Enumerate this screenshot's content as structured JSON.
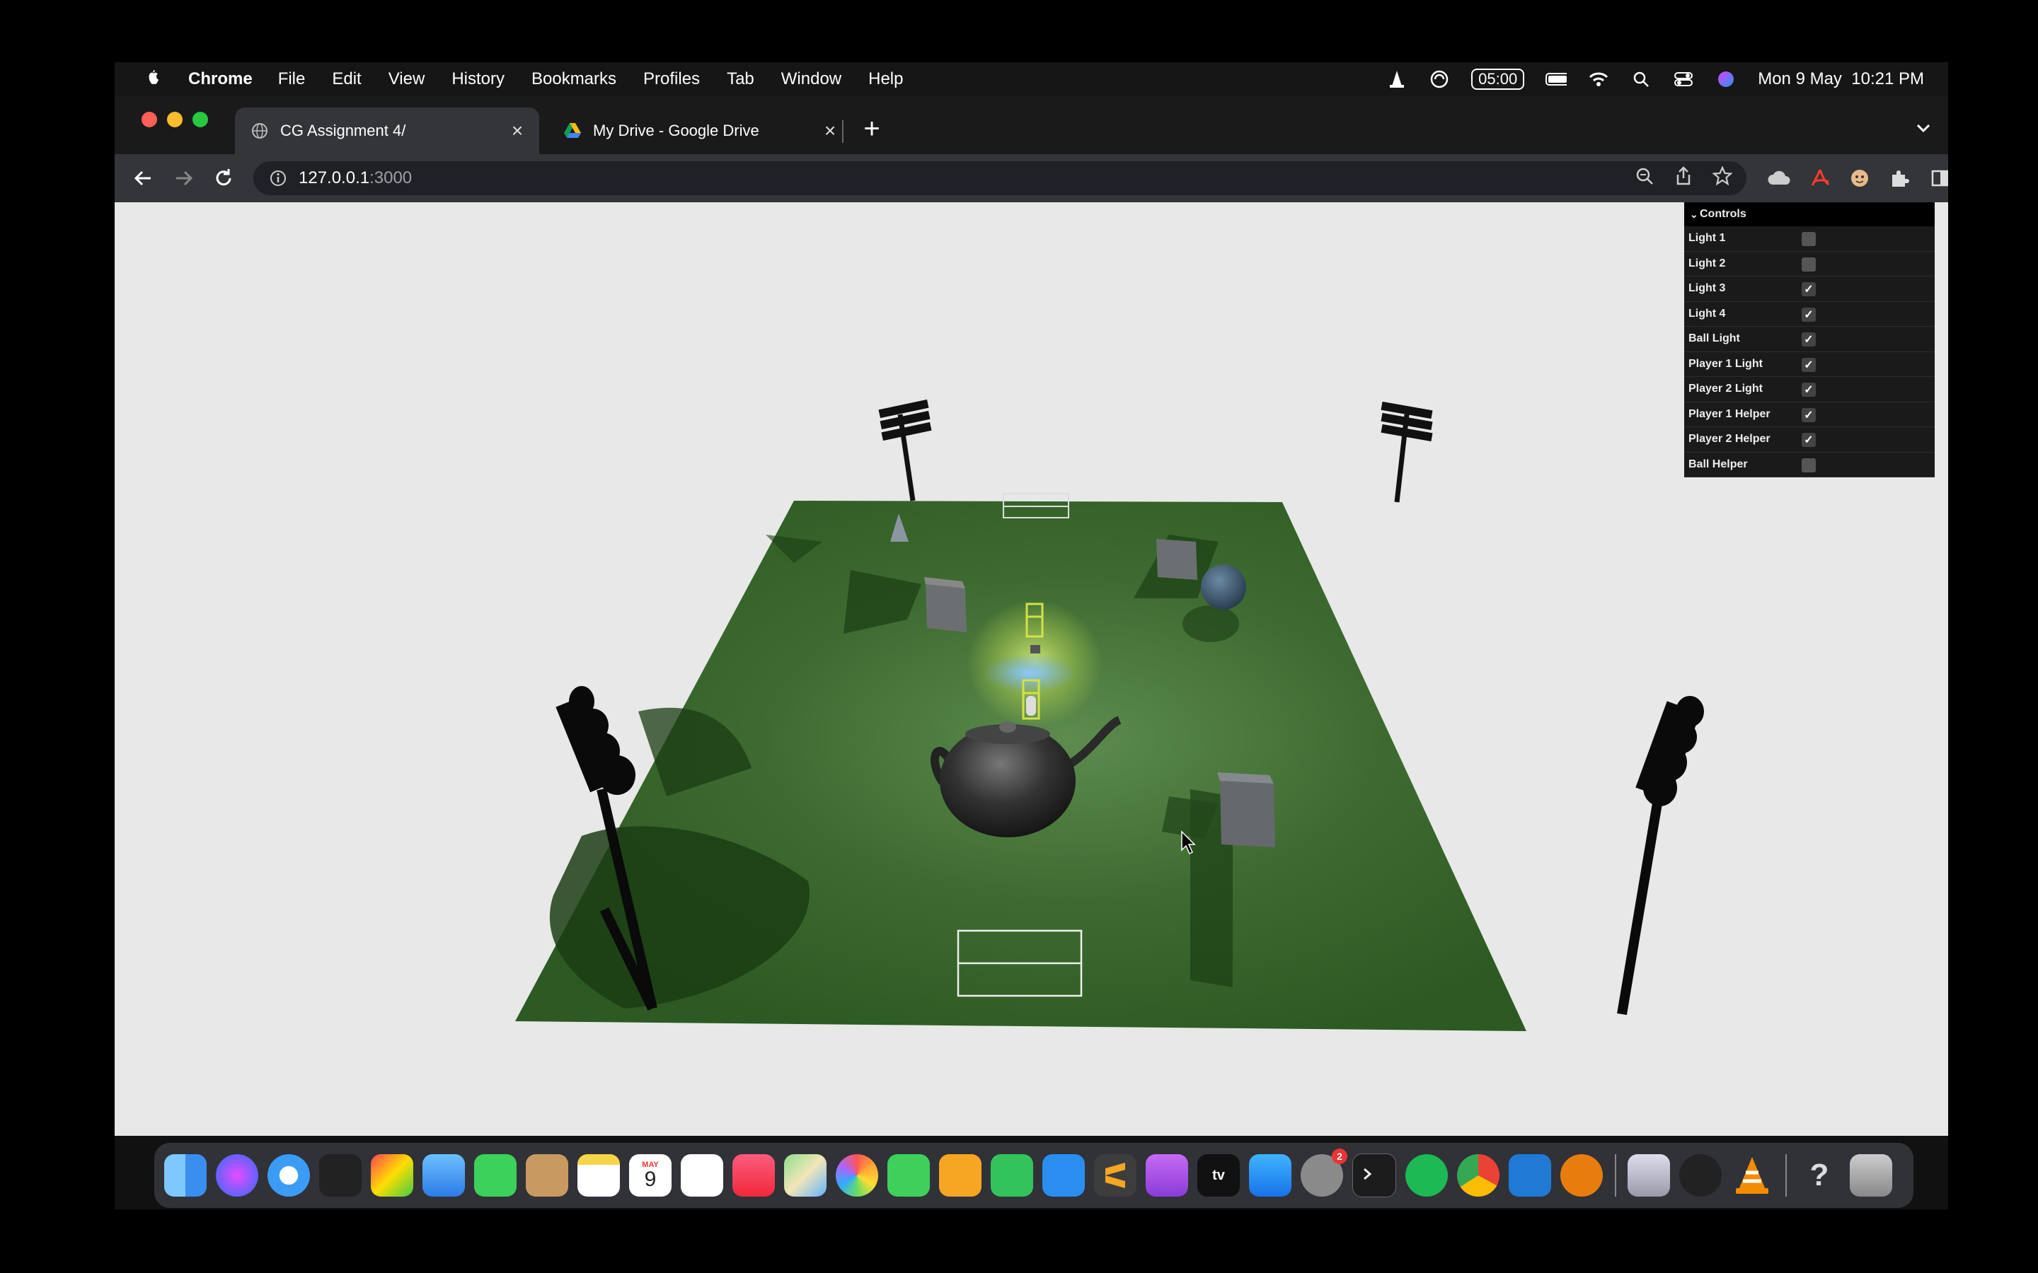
{
  "menubar": {
    "app": "Chrome",
    "items": [
      "File",
      "Edit",
      "View",
      "History",
      "Bookmarks",
      "Profiles",
      "Tab",
      "Window",
      "Help"
    ],
    "timer": "05:00",
    "clock": "Mon 9 May  10:21 PM"
  },
  "tabs": [
    {
      "title": "CG Assignment 4/",
      "active": true
    },
    {
      "title": "My Drive - Google Drive",
      "active": false
    }
  ],
  "omnibox": {
    "host": "127.0.0.1",
    "port": ":3000"
  },
  "gui": {
    "title": "Controls",
    "rows": [
      {
        "label": "Light 1",
        "checked": false
      },
      {
        "label": "Light 2",
        "checked": false
      },
      {
        "label": "Light 3",
        "checked": true
      },
      {
        "label": "Light 4",
        "checked": true
      },
      {
        "label": "Ball Light",
        "checked": true
      },
      {
        "label": "Player 1 Light",
        "checked": true
      },
      {
        "label": "Player 2 Light",
        "checked": true
      },
      {
        "label": "Player 1 Helper",
        "checked": true
      },
      {
        "label": "Player 2 Helper",
        "checked": true
      },
      {
        "label": "Ball Helper",
        "checked": false
      }
    ]
  },
  "dock": {
    "calendar_month": "MAY",
    "calendar_day": "9",
    "tv_label": "tv",
    "settings_badge": "2",
    "help_label": "?",
    "apps": [
      "finder-icon",
      "siri-icon",
      "safari-icon",
      "mission-control-icon",
      "launchpad-icon",
      "mail-icon",
      "facetime-icon",
      "contacts-icon",
      "notes-icon",
      "calendar-icon",
      "reminders-icon",
      "music-icon",
      "maps-icon",
      "photos-icon",
      "messages-icon",
      "pages-icon",
      "numbers-icon",
      "keynote-icon",
      "sublime-icon",
      "podcasts-icon",
      "apple-tv-icon",
      "app-store-icon",
      "system-preferences-icon",
      "terminal-icon",
      "spotify-icon",
      "chrome-icon",
      "vscode-icon",
      "blender-icon",
      "preview-icon",
      "unity-icon",
      "vlc-icon",
      "help-icon",
      "trash-icon"
    ]
  },
  "colors": {
    "field": "#3a6a2c",
    "background": "#e8e8e8",
    "gui_bg": "#1a1a1a"
  }
}
